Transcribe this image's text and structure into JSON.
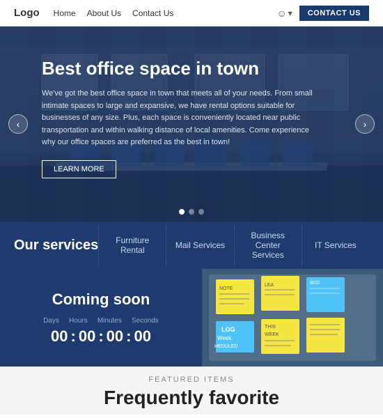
{
  "navbar": {
    "logo": "Logo",
    "links": [
      "Home",
      "About Us",
      "Contact Us"
    ],
    "contact_button": "CONTACT US"
  },
  "hero": {
    "title": "Best office space in town",
    "description": "We've got the best office space in town that meets all of your needs. From small intimate spaces to large and expansive, we have rental options suitable for businesses of any size. Plus, each space is conveniently located near public transportation and within walking distance of local amenities. Come experience why our office spaces are preferred as the best in town!",
    "cta_button": "LEARN MORE",
    "dots": [
      {
        "active": true
      },
      {
        "active": false
      },
      {
        "active": false
      }
    ]
  },
  "services": {
    "title": "Our services",
    "items": [
      {
        "label": "Furniture Rental"
      },
      {
        "label": "Mail Services"
      },
      {
        "label": "Business Center Services"
      },
      {
        "label": "IT Services"
      }
    ]
  },
  "coming_soon": {
    "title": "Coming soon",
    "labels": [
      "Days",
      "Hours",
      "Minutes",
      "Seconds"
    ],
    "values": [
      "00",
      "00",
      "00",
      "00"
    ]
  },
  "featured": {
    "label": "FEATURED ITEMS",
    "title": "Frequently favorite"
  }
}
